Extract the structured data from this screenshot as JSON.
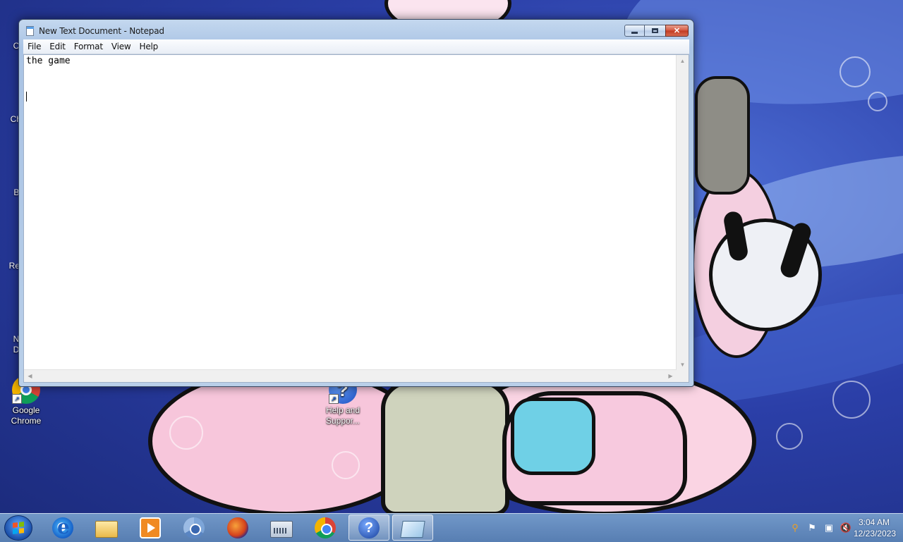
{
  "window": {
    "title": "New Text Document - Notepad",
    "buttons": {
      "minimize": "minimize-icon",
      "maximize": "maximize-icon",
      "close": "close-icon"
    }
  },
  "menu": {
    "items": [
      "File",
      "Edit",
      "Format",
      "View",
      "Help"
    ]
  },
  "editor": {
    "content": "the game\n\n"
  },
  "desktop": {
    "icons": [
      {
        "label": "Google Chrome",
        "icon": "chrome-icon"
      },
      {
        "label": "Help and Suppor...",
        "icon": "help-icon"
      }
    ],
    "partial_labels": [
      "Co",
      "Chr",
      "Ba",
      "Rec",
      "Ne",
      "Do"
    ]
  },
  "taskbar": {
    "pinned": [
      {
        "name": "internet-explorer-icon"
      },
      {
        "name": "windows-explorer-icon"
      },
      {
        "name": "media-player-icon"
      },
      {
        "name": "chromium-icon"
      },
      {
        "name": "firefox-icon"
      },
      {
        "name": "on-screen-keyboard-icon"
      },
      {
        "name": "chrome-icon"
      },
      {
        "name": "help-and-support-icon"
      },
      {
        "name": "notepad-icon",
        "active": true
      }
    ],
    "tray": [
      "search-icon",
      "action-center-flag-icon",
      "network-icon",
      "volume-muted-icon"
    ],
    "clock": {
      "time": "3:04 AM",
      "date": "12/23/2023"
    }
  },
  "colors": {
    "close_button": "#c23b22",
    "taskbar": "#5a82b4",
    "wallpaper": "#2b3fa8"
  }
}
